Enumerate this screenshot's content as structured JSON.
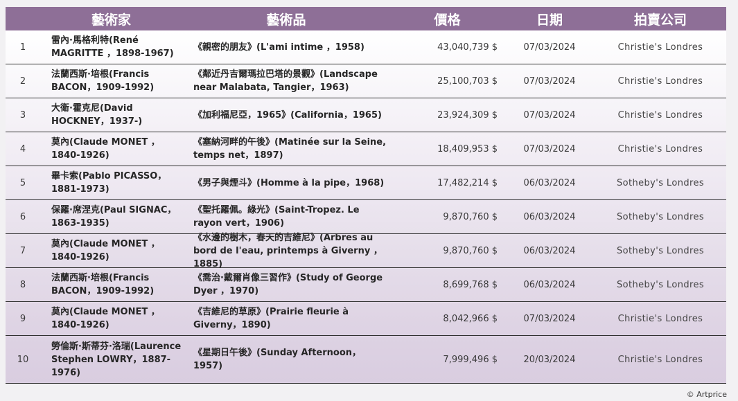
{
  "header": {
    "artist": "藝術家",
    "artwork": "藝術品",
    "price": "價格",
    "date": "日期",
    "auction_house": "拍賣公司"
  },
  "colors": {
    "header_bg": "#8e6f97",
    "row_top": "#ffffff",
    "row_bottom": "#d9cde0"
  },
  "rows": [
    {
      "rank": "1",
      "artist": "雷內·馬格利特(René MAGRITTE ，1898-1967)",
      "artwork": "《親密的朋友》(L'ami intime ，1958)",
      "price": "43,040,739 $",
      "date": "07/03/2024",
      "house": "Christie's Londres"
    },
    {
      "rank": "2",
      "artist": "法蘭西斯·培根(Francis BACON，1909-1992)",
      "artwork": "《鄰近丹吉爾瑪拉巴塔的景觀》(Landscape near Malabata, Tangier，1963)",
      "price": "25,100,703 $",
      "date": "07/03/2024",
      "house": "Christie's Londres"
    },
    {
      "rank": "3",
      "artist": "大衛·霍克尼(David HOCKNEY，1937-)",
      "artwork": "《加利福尼亞，1965》(California，1965)",
      "price": "23,924,309 $",
      "date": "07/03/2024",
      "house": "Christie's Londres"
    },
    {
      "rank": "4",
      "artist": "莫內(Claude MONET ，1840-1926)",
      "artwork": "《塞納河畔的午後》(Matinée sur la Seine, temps net，1897)",
      "price": "18,409,953 $",
      "date": "07/03/2024",
      "house": "Christie's Londres"
    },
    {
      "rank": "5",
      "artist": "畢卡索(Pablo PICASSO，1881-1973)",
      "artwork": "《男子與煙斗》(Homme à la pipe，1968)",
      "price": "17,482,214 $",
      "date": "06/03/2024",
      "house": "Sotheby's Londres"
    },
    {
      "rank": "6",
      "artist": "保羅·席涅克(Paul SIGNAC，1863-1935)",
      "artwork": "《聖托羅佩。綠光》(Saint-Tropez. Le rayon vert，1906)",
      "price": "9,870,760 $",
      "date": "06/03/2024",
      "house": "Sotheby's Londres"
    },
    {
      "rank": "7",
      "artist": "莫內(Claude MONET ，1840-1926)",
      "artwork": "《水邊的樹木，春天的吉維尼》(Arbres au bord de l'eau, printemps à Giverny ，1885)",
      "price": "9,870,760 $",
      "date": "06/03/2024",
      "house": "Sotheby's Londres"
    },
    {
      "rank": "8",
      "artist": "法蘭西斯·培根(Francis BACON，1909-1992)",
      "artwork": "《喬治·戴爾肖像三習作》(Study of George Dyer ，1970)",
      "price": "8,699,768 $",
      "date": "06/03/2024",
      "house": "Sotheby's Londres"
    },
    {
      "rank": "9",
      "artist": "莫內(Claude MONET ，1840-1926)",
      "artwork": "《吉維尼的草原》(Prairie fleurie à Giverny，1890)",
      "price": "8,042,966 $",
      "date": "07/03/2024",
      "house": "Christie's Londres"
    },
    {
      "rank": "10",
      "artist": "勞倫斯·斯蒂芬·洛瑞(Laurence Stephen LOWRY，1887-1976)",
      "artwork": "《星期日午後》(Sunday Afternoon，1957)",
      "price": "7,999,496 $",
      "date": "20/03/2024",
      "house": "Christie's Londres"
    }
  ],
  "credit": "© Artprice"
}
